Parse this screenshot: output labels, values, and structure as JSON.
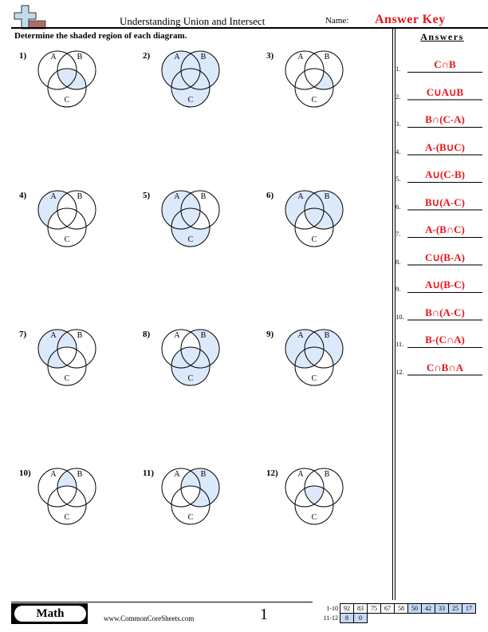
{
  "header": {
    "title": "Understanding Union and Intersect",
    "name_label": "Name:",
    "name_value": "Answer Key",
    "logo_icon": "plus-ruler-logo-icon"
  },
  "instructions": "Determine the shaded region of each diagram.",
  "colors": {
    "shade": "#dbe9fb",
    "answer_red": "#e8141b",
    "score_blue": "#c6d9f7"
  },
  "venn_labels": {
    "a": "A",
    "b": "B",
    "c": "C"
  },
  "problems": [
    {
      "number": "1)",
      "shaded": [
        "BC",
        "ABC"
      ]
    },
    {
      "number": "2)",
      "shaded": [
        "A",
        "B",
        "C",
        "AB",
        "AC",
        "BC",
        "ABC"
      ]
    },
    {
      "number": "3)",
      "shaded": [
        "BC"
      ]
    },
    {
      "number": "4)",
      "shaded": [
        "A"
      ]
    },
    {
      "number": "5)",
      "shaded": [
        "A",
        "AB",
        "AC",
        "ABC",
        "C"
      ]
    },
    {
      "number": "6)",
      "shaded": [
        "A",
        "B",
        "AB",
        "BC",
        "ABC"
      ]
    },
    {
      "number": "7)",
      "shaded": [
        "A",
        "AB",
        "AC"
      ]
    },
    {
      "number": "8)",
      "shaded": [
        "B",
        "C",
        "AC",
        "BC",
        "ABC"
      ]
    },
    {
      "number": "9)",
      "shaded": [
        "A",
        "B",
        "AB",
        "AC",
        "ABC"
      ]
    },
    {
      "number": "10)",
      "shaded": [
        "AB"
      ]
    },
    {
      "number": "11)",
      "shaded": [
        "B",
        "AB",
        "BC"
      ]
    },
    {
      "number": "12)",
      "shaded": [
        "ABC"
      ]
    }
  ],
  "answers": {
    "title": "Answers",
    "items": [
      {
        "number": "1.",
        "text": "C∩B"
      },
      {
        "number": "2.",
        "text": "C∪A∪B"
      },
      {
        "number": "3.",
        "text": "B∩(C-A)"
      },
      {
        "number": "4.",
        "text": "A-(B∪C)"
      },
      {
        "number": "5.",
        "text": "A∪(C-B)"
      },
      {
        "number": "6.",
        "text": "B∪(A-C)"
      },
      {
        "number": "7.",
        "text": "A-(B∩C)"
      },
      {
        "number": "8.",
        "text": "C∪(B-A)"
      },
      {
        "number": "9.",
        "text": "A∪(B-C)"
      },
      {
        "number": "10.",
        "text": "B∩(A-C)"
      },
      {
        "number": "11.",
        "text": "B-(C∩A)"
      },
      {
        "number": "12.",
        "text": "C∩B∩A"
      }
    ]
  },
  "footer": {
    "badge": "Math",
    "site": "www.CommonCoreSheets.com",
    "page": "1",
    "score_rows": [
      {
        "label": "1-10",
        "cells": [
          {
            "v": "92",
            "blue": false
          },
          {
            "v": "83",
            "blue": false
          },
          {
            "v": "75",
            "blue": false
          },
          {
            "v": "67",
            "blue": false
          },
          {
            "v": "58",
            "blue": false
          },
          {
            "v": "50",
            "blue": true
          },
          {
            "v": "42",
            "blue": true
          },
          {
            "v": "33",
            "blue": true
          },
          {
            "v": "25",
            "blue": true
          },
          {
            "v": "17",
            "blue": true
          }
        ]
      },
      {
        "label": "11-12",
        "cells": [
          {
            "v": "8",
            "blue": true
          },
          {
            "v": "0",
            "blue": true
          }
        ]
      }
    ]
  }
}
